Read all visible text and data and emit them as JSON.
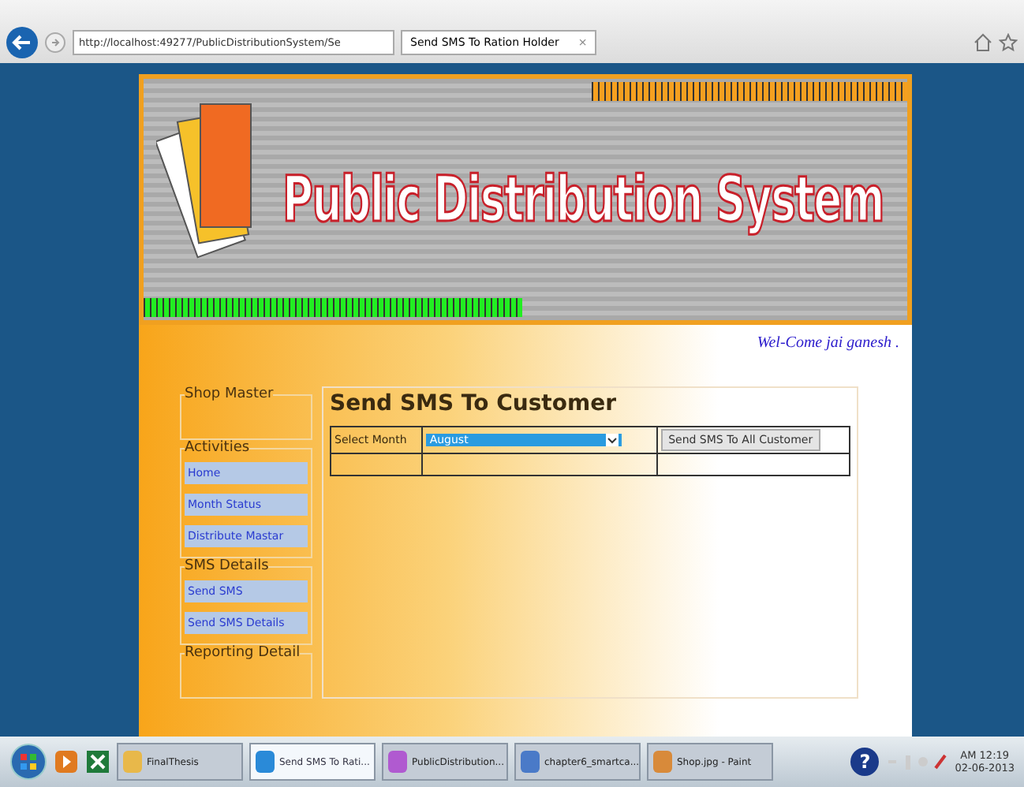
{
  "browser": {
    "address": "http://localhost:49277/PublicDistributionSystem/Se",
    "tab_title": "Send SMS To Ration Holder",
    "tab_close": "×"
  },
  "banner": {
    "title": "Public Distribution System"
  },
  "welcome": "Wel-Come jai ganesh .",
  "sidebar": [
    {
      "heading": "Shop Master"
    },
    {
      "heading": "Activities",
      "items": [
        "Home",
        "Month Status",
        "Distribute Mastar"
      ]
    },
    {
      "heading": "SMS Details",
      "items": [
        "Send SMS",
        "Send SMS Details"
      ]
    },
    {
      "heading": "Reporting Detail"
    }
  ],
  "form": {
    "title": "Send SMS To Customer",
    "month_label": "Select Month",
    "month_value": "August",
    "button": "Send SMS To All Customer"
  },
  "taskbar": {
    "items": [
      {
        "label": "FinalThesis",
        "selected": false,
        "kind": "folder"
      },
      {
        "label": "Send SMS To Rati...",
        "selected": true,
        "kind": "browser"
      },
      {
        "label": "PublicDistribution...",
        "selected": false,
        "kind": "studio"
      },
      {
        "label": "chapter6_smartca...",
        "selected": false,
        "kind": "document"
      },
      {
        "label": "Shop.jpg - Paint",
        "selected": false,
        "kind": "paint"
      }
    ],
    "help": "?",
    "time": "AM 12:19",
    "date": "02-06-2013"
  }
}
